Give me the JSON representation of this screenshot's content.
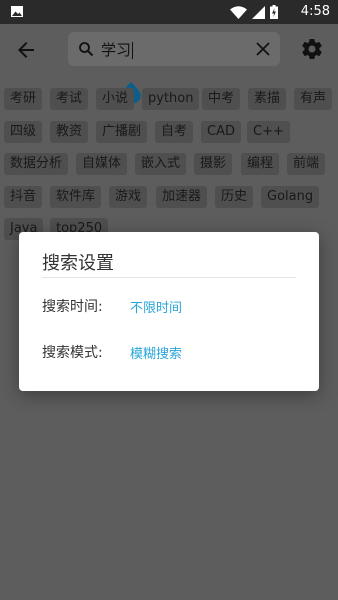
{
  "status_bar": {
    "time": "4:58"
  },
  "search": {
    "query": "学习"
  },
  "hot_tags": [
    [
      "考研",
      "考试",
      "小说",
      "python",
      "中考",
      "素描",
      "有声"
    ],
    [
      "四级",
      "教资",
      "广播剧",
      "自考",
      "CAD",
      "C++"
    ],
    [
      "数据分析",
      "自媒体",
      "嵌入式",
      "摄影",
      "编程",
      "前端"
    ],
    [
      "抖音",
      "软件库",
      "游戏",
      "加速器",
      "历史",
      "Golang"
    ],
    [
      "Java",
      "top250"
    ]
  ],
  "dialog": {
    "title": "搜索设置",
    "time_label": "搜索时间:",
    "time_value": "不限时间",
    "mode_label": "搜索模式:",
    "mode_value": "模糊搜索"
  },
  "colors": {
    "accent": "#2aa5d8",
    "scrim": "#5d5d5d"
  }
}
